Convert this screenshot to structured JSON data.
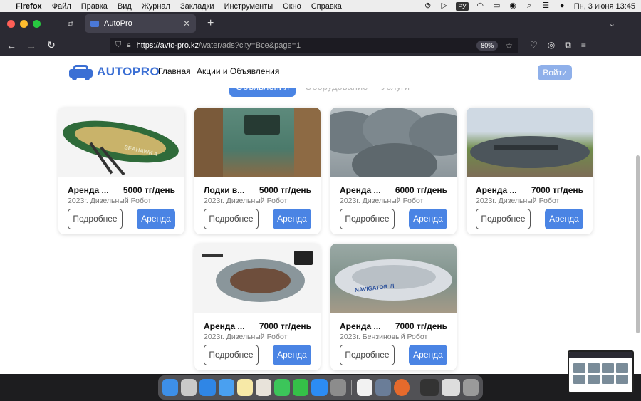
{
  "menubar": {
    "app": "Firefox",
    "items": [
      "Файл",
      "Правка",
      "Вид",
      "Журнал",
      "Закладки",
      "Инструменты",
      "Окно",
      "Справка"
    ],
    "input_lang": "РУ",
    "clock": "Пн, 3 июня  13:45"
  },
  "browser": {
    "tab_title": "AutoPro",
    "url_host": "https://avto-pro.kz",
    "url_path": "/water/ads?city=Все&page=1",
    "zoom": "80%"
  },
  "site": {
    "logo_text": "AUTOPRO",
    "nav": [
      "Главная",
      "Акции и Объявления"
    ],
    "login": "Войти",
    "segments": [
      "Объявления",
      "Оборудование",
      "Услуги"
    ]
  },
  "listings": [
    {
      "title": "Аренда ...",
      "price": "5000 тг/день",
      "meta": "2023г.  Дизельный  Робот",
      "more": "Подробнее",
      "rent": "Аренда"
    },
    {
      "title": "Лодки в...",
      "price": "5000 тг/день",
      "meta": "2023г.  Дизельный  Робот",
      "more": "Подробнее",
      "rent": "Аренда"
    },
    {
      "title": "Аренда ...",
      "price": "6000 тг/день",
      "meta": "2023г.  Дизельный  Робот",
      "more": "Подробнее",
      "rent": "Аренда"
    },
    {
      "title": "Аренда ...",
      "price": "7000 тг/день",
      "meta": "2023г.  Дизельный  Робот",
      "more": "Подробнее",
      "rent": "Аренда"
    },
    {
      "title": "Аренда ...",
      "price": "7000 тг/день",
      "meta": "2023г.  Дизельный  Робот",
      "more": "Подробнее",
      "rent": "Аренда"
    },
    {
      "title": "Аренда ...",
      "price": "7000 тг/день",
      "meta": "2023г.  Бензиновый  Робот",
      "more": "Подробнее",
      "rent": "Аренда"
    }
  ],
  "image_text": {
    "seahawk": "SEAHAWK 4",
    "navigator": "NAVIGATOR III"
  }
}
